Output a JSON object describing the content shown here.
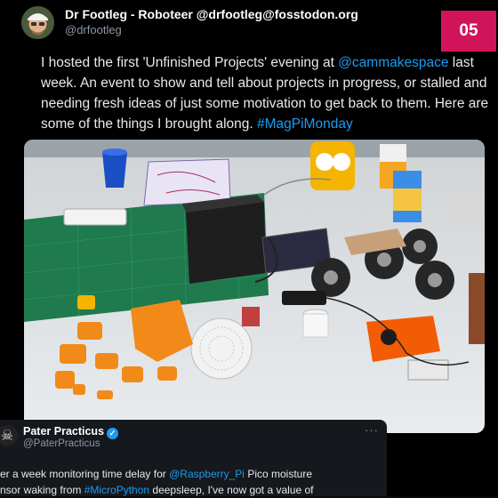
{
  "main_tweet": {
    "display_name": "Dr Footleg - Roboteer @drfootleg@fosstodon.org",
    "handle": "@drfootleg",
    "text_1": "I hosted the first 'Unfinished Projects' evening at ",
    "mention_1": "@cammakespace",
    "text_2": " last week. An event to show and tell about projects in progress, or stalled and needing fresh ideas of just some motivation to get back to them. Here are some of the things I brought along. ",
    "hashtag_1": "#MagPiMonday"
  },
  "badge": {
    "label": "05",
    "color": "#d1145a"
  },
  "quote_tweet": {
    "display_name": "Pater Practicus",
    "handle": "@PaterPracticus",
    "more_label": "···",
    "text_1": "er a week monitoring time delay for ",
    "mention_1": "@Raspberry_Pi",
    "text_2": " Pico moisture",
    "text_3": "nsor waking from ",
    "hashtag_1": "#MicroPython",
    "text_4": " deepsleep, I've now got a value of"
  },
  "colors": {
    "link": "#1d9bf0",
    "background": "#000000",
    "card": "#15181c"
  },
  "icons": {
    "verified": "verified-badge-icon",
    "quote_avatar": "skull-crossbones-icon"
  }
}
